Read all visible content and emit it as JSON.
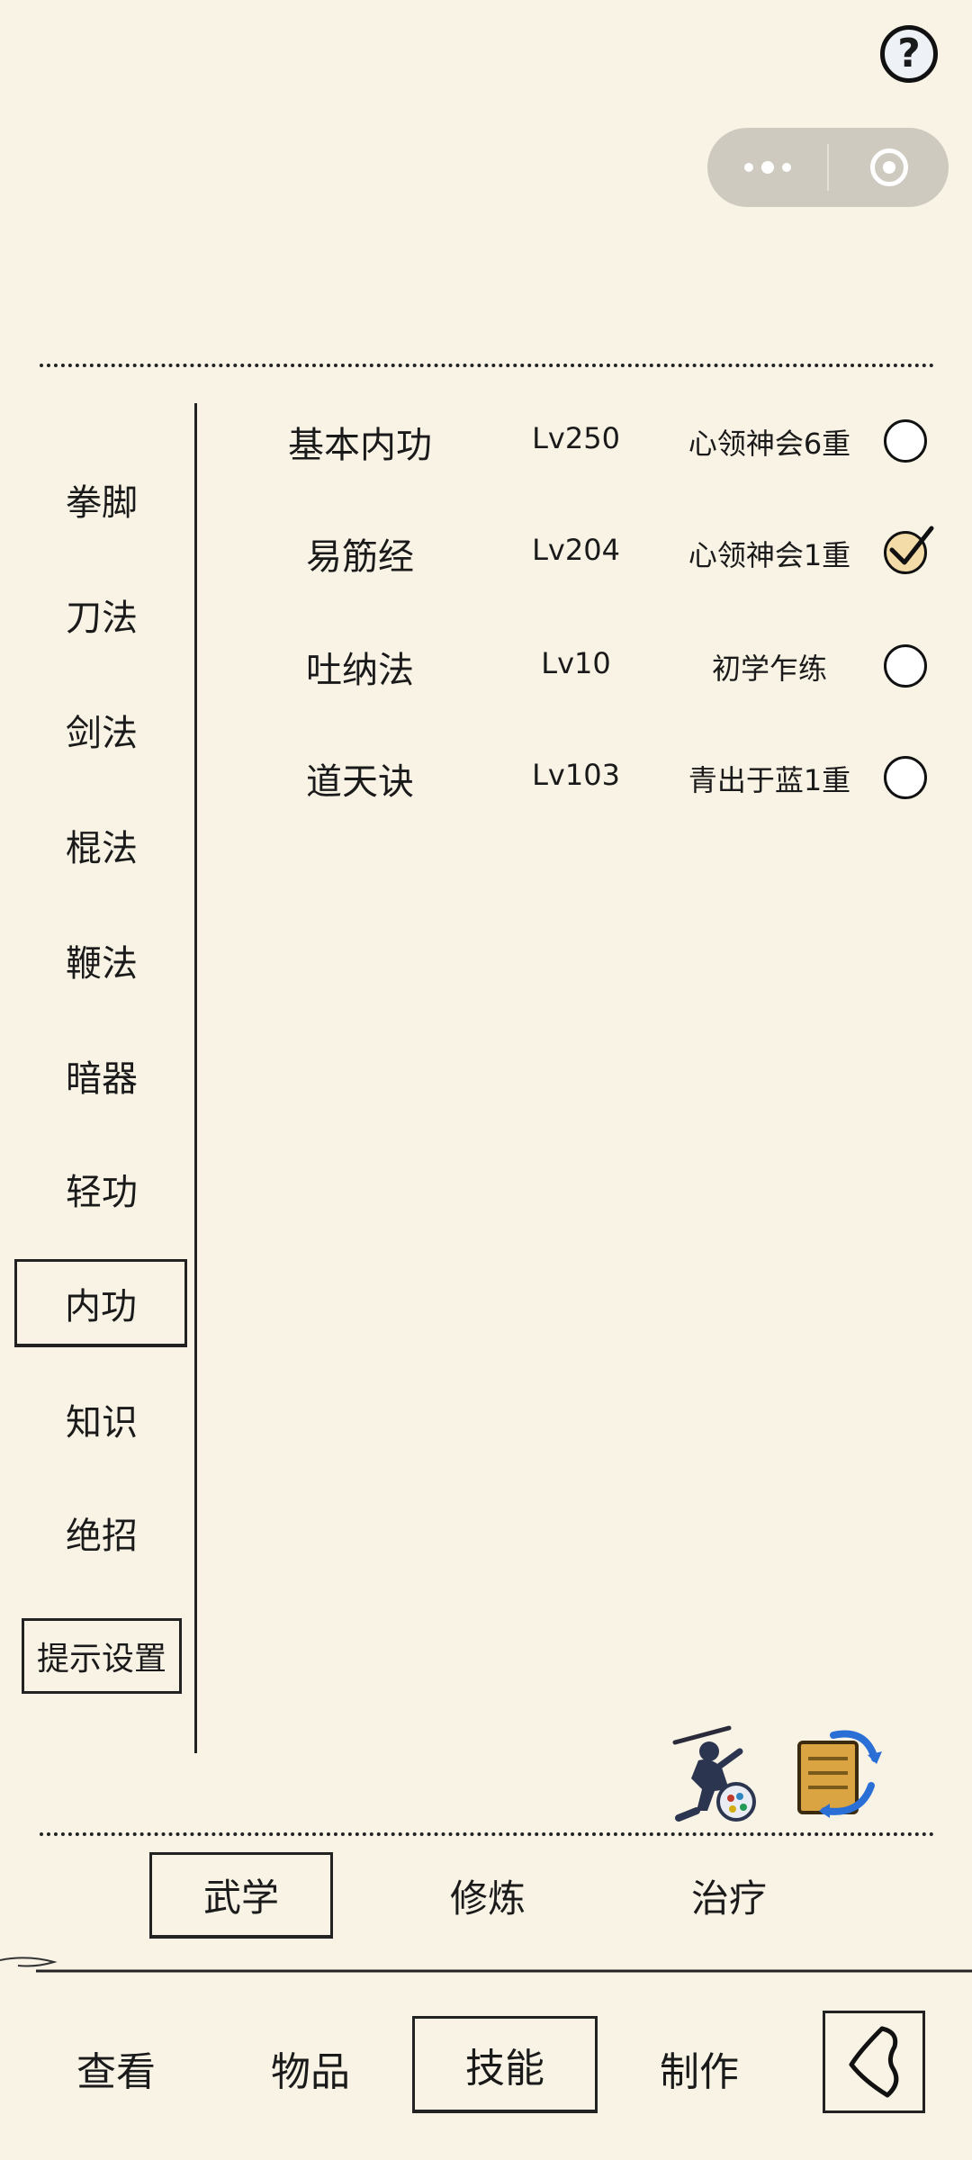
{
  "header": {
    "help_label": "?"
  },
  "sidebar": {
    "items": [
      {
        "label": "拳脚"
      },
      {
        "label": "刀法"
      },
      {
        "label": "剑法"
      },
      {
        "label": "棍法"
      },
      {
        "label": "鞭法"
      },
      {
        "label": "暗器"
      },
      {
        "label": "轻功"
      },
      {
        "label": "内功",
        "selected": true
      },
      {
        "label": "知识"
      },
      {
        "label": "绝招"
      }
    ],
    "tip_settings_label": "提示设置"
  },
  "skills": [
    {
      "name": "基本内功",
      "level": "Lv250",
      "state": "心领神会6重",
      "checked": false
    },
    {
      "name": "易筋经",
      "level": "Lv204",
      "state": "心领神会1重",
      "checked": true
    },
    {
      "name": "吐纳法",
      "level": "Lv10",
      "state": "初学乍练",
      "checked": false
    },
    {
      "name": "道天诀",
      "level": "Lv103",
      "state": "青出于蓝1重",
      "checked": false
    }
  ],
  "icons": {
    "left": "ninja-fighter-icon",
    "right": "scroll-swap-icon"
  },
  "sub_tabs": [
    {
      "label": "武学",
      "selected": true
    },
    {
      "label": "修炼"
    },
    {
      "label": "治疗"
    }
  ],
  "bottom_nav": [
    {
      "label": "查看"
    },
    {
      "label": "物品"
    },
    {
      "label": "技能",
      "selected": true
    },
    {
      "label": "制作"
    }
  ],
  "colors": {
    "background": "#f9f3e6",
    "capsule": "#cfcac0",
    "checked_fill": "#f4dca8"
  }
}
